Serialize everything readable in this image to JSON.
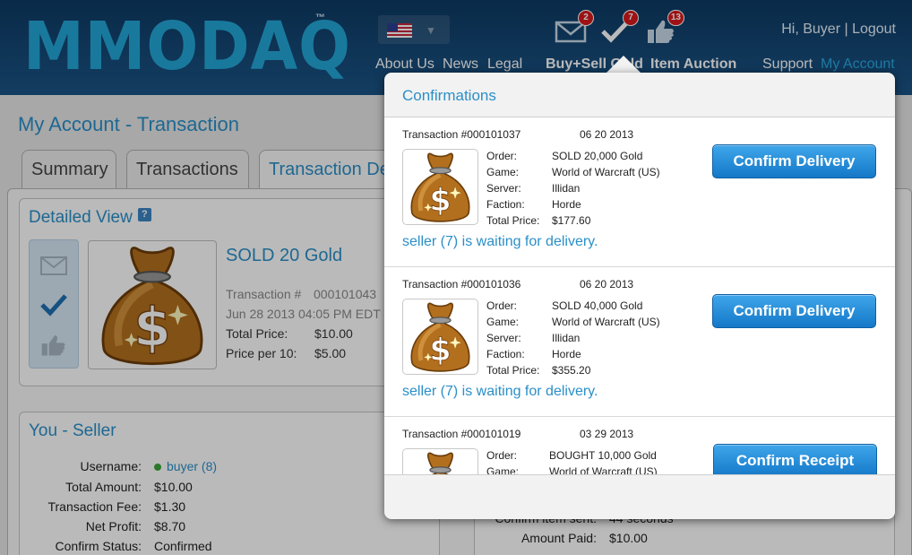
{
  "header": {
    "logo": "MMODAQ",
    "trademark": "™",
    "greeting": "Hi, Buyer | Logout",
    "nav": [
      {
        "label": "About Us"
      },
      {
        "label": "News"
      },
      {
        "label": "Legal"
      },
      {
        "label": "Buy+Sell Gold"
      },
      {
        "label": "Item Auction"
      },
      {
        "label": "Support"
      },
      {
        "label": "My Account"
      }
    ],
    "badges": {
      "mail": "2",
      "confirm": "7",
      "feedback": "13"
    },
    "flag_dropdown": "▼"
  },
  "page": {
    "title": "My Account - Transaction",
    "tabs": [
      "Summary",
      "Transactions",
      "Transaction De"
    ]
  },
  "detail": {
    "heading": "Detailed View",
    "help": "?",
    "item_title": "SOLD 20 Gold",
    "transaction_label": "Transaction #",
    "transaction_no": "000101043",
    "date": "Jun 28 2013 04:05 PM EDT",
    "total_price_label": "Total Price:",
    "total_price": "$10.00",
    "price_per_label": "Price per 10:",
    "price_per": "$5.00"
  },
  "seller": {
    "heading": "You - Seller",
    "rows": [
      {
        "label": "Username:",
        "value": "buyer (8)"
      },
      {
        "label": "Total Amount:",
        "value": "$10.00"
      },
      {
        "label": "Transaction Fee:",
        "value": "$1.30"
      },
      {
        "label": "Net Profit:",
        "value": "$8.70"
      },
      {
        "label": "Confirm Status:",
        "value": "Confirmed"
      }
    ]
  },
  "buyer_box": {
    "rows": [
      {
        "label": "Confirm item sent:",
        "value": "44 seconds"
      },
      {
        "label": "Amount Paid:",
        "value": "$10.00"
      }
    ]
  },
  "popup": {
    "title": "Confirmations",
    "field_labels": [
      "Order:",
      "Game:",
      "Server:",
      "Faction:",
      "Total Price:"
    ],
    "transactions": [
      {
        "id": "Transaction #000101037",
        "date": "06 20 2013",
        "order": "SOLD 20,000 Gold",
        "game": "World of Warcraft (US)",
        "server": "Illidan",
        "faction": "Horde",
        "total": "$177.60",
        "status": "seller (7) is waiting for delivery.",
        "button": "Confirm Delivery"
      },
      {
        "id": "Transaction #000101036",
        "date": "06 20 2013",
        "order": "SOLD 40,000 Gold",
        "game": "World of Warcraft (US)",
        "server": "Illidan",
        "faction": "Horde",
        "total": "$355.20",
        "status": "seller (7) is waiting for delivery.",
        "button": "Confirm Delivery"
      },
      {
        "id": "Transaction #000101019",
        "date": "03 29 2013",
        "order": "BOUGHT 10,000 Gold",
        "game": "World of Warcraft (US)",
        "button": "Confirm Receipt"
      }
    ]
  },
  "colors": {
    "accent": "#2a8fc8",
    "header": "#0e3a63",
    "badge": "#d7191c",
    "button": "#1478c8",
    "logo": "#23a6d8"
  },
  "icons": [
    "mail-icon",
    "checkmark-icon",
    "thumbs-up-icon",
    "help-icon",
    "money-bag-icon",
    "us-flag-icon",
    "online-dot-icon"
  ]
}
